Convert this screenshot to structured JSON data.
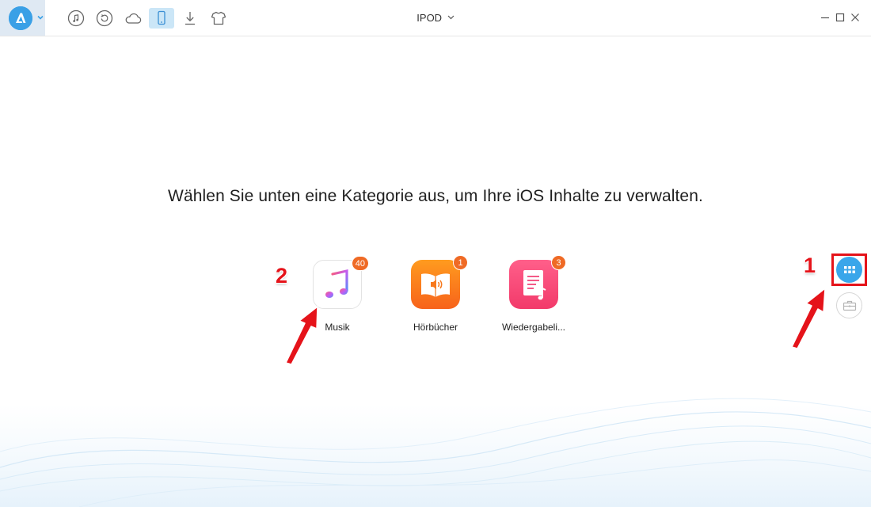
{
  "titlebar": {
    "device_name": "IPOD",
    "icons": [
      "music-icon",
      "restore-icon",
      "cloud-icon",
      "device-icon",
      "download-icon",
      "shirt-icon"
    ]
  },
  "main": {
    "heading": "Wählen Sie unten eine Kategorie aus, um Ihre iOS Inhalte zu verwalten.",
    "categories": [
      {
        "label": "Musik",
        "count": "40",
        "icon": "music-note-icon"
      },
      {
        "label": "Hörbücher",
        "count": "1",
        "icon": "audiobook-icon"
      },
      {
        "label": "Wiedergabeli...",
        "count": "3",
        "icon": "playlist-icon"
      }
    ]
  },
  "annotations": {
    "marker_1": "1",
    "marker_2": "2"
  },
  "colors": {
    "accent": "#3aa6ea",
    "badge": "#ef6a25",
    "annotation": "#e5131a"
  }
}
